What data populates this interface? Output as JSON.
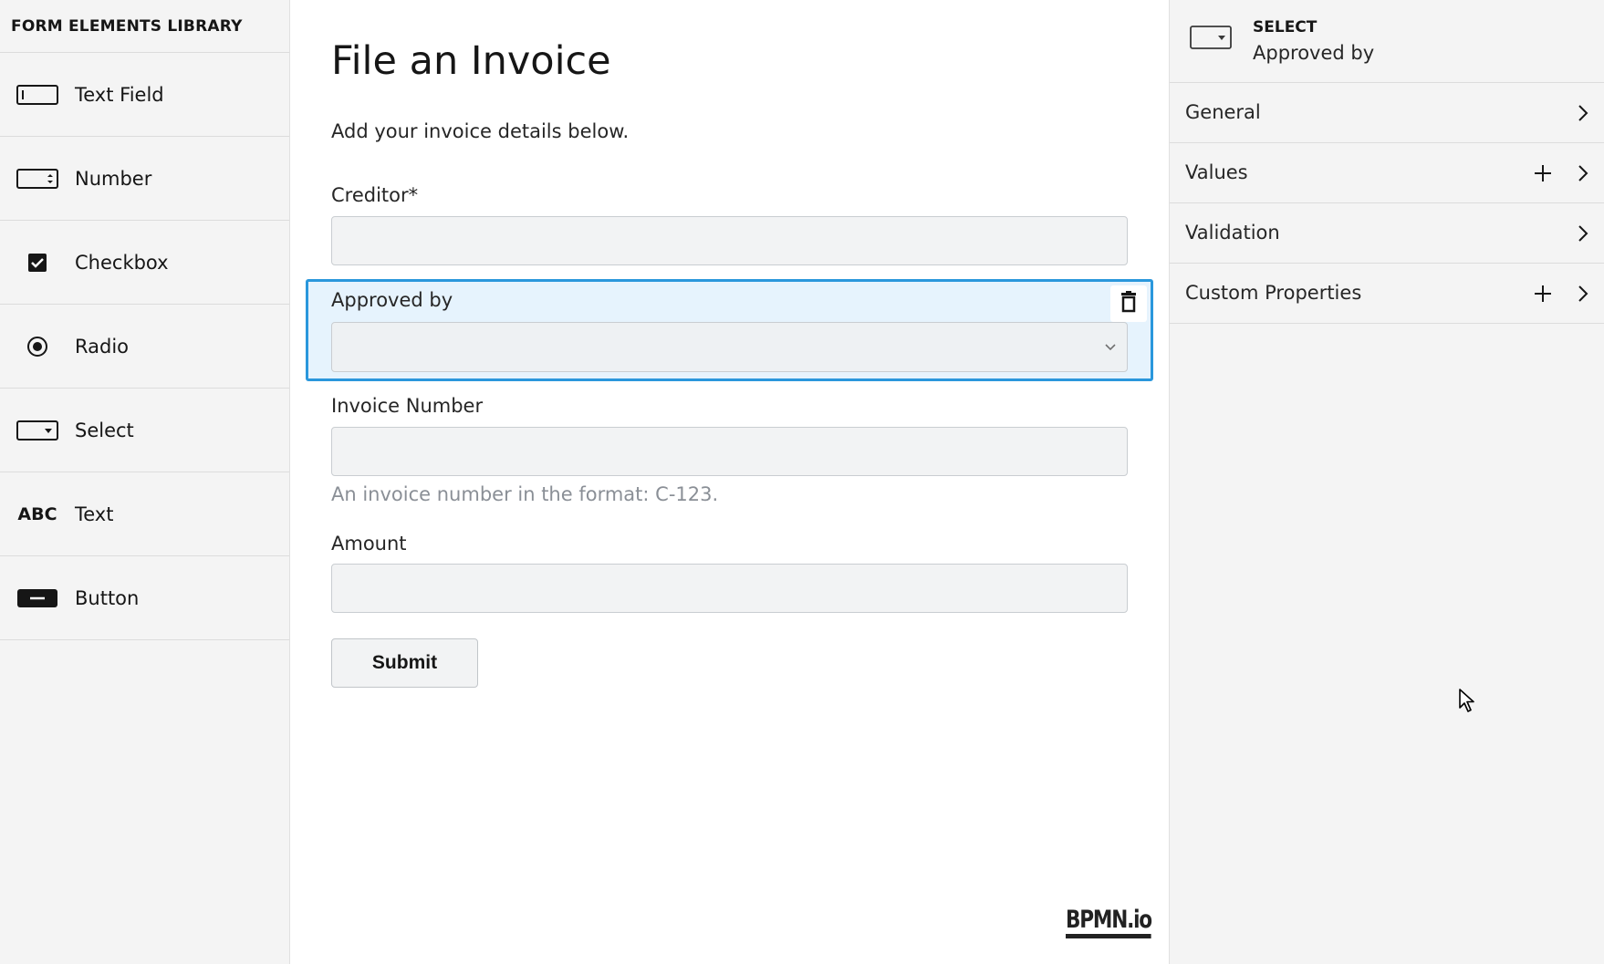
{
  "palette": {
    "title": "FORM ELEMENTS LIBRARY",
    "items": [
      {
        "label": "Text Field",
        "icon": "textfield-icon"
      },
      {
        "label": "Number",
        "icon": "number-icon"
      },
      {
        "label": "Checkbox",
        "icon": "checkbox-icon"
      },
      {
        "label": "Radio",
        "icon": "radio-icon"
      },
      {
        "label": "Select",
        "icon": "select-icon"
      },
      {
        "label": "Text",
        "icon": "text-icon",
        "icon_text": "ABC"
      },
      {
        "label": "Button",
        "icon": "button-icon"
      }
    ]
  },
  "form": {
    "title": "File an Invoice",
    "description": "Add your invoice details below.",
    "creditor_label": "Creditor*",
    "approved_by_label": "Approved by",
    "invoice_number_label": "Invoice Number",
    "invoice_number_hint": "An invoice number in the format: C-123.",
    "amount_label": "Amount",
    "submit_label": "Submit"
  },
  "brand": {
    "logo_text": "BPMN.io"
  },
  "properties": {
    "element_type": "SELECT",
    "element_name": "Approved by",
    "groups": [
      {
        "label": "General",
        "add": false
      },
      {
        "label": "Values",
        "add": true
      },
      {
        "label": "Validation",
        "add": false
      },
      {
        "label": "Custom Properties",
        "add": true
      }
    ]
  },
  "colors": {
    "selection_border": "#2a97dc",
    "selection_background": "#e6f3fd",
    "panel_background": "#f4f4f4"
  }
}
